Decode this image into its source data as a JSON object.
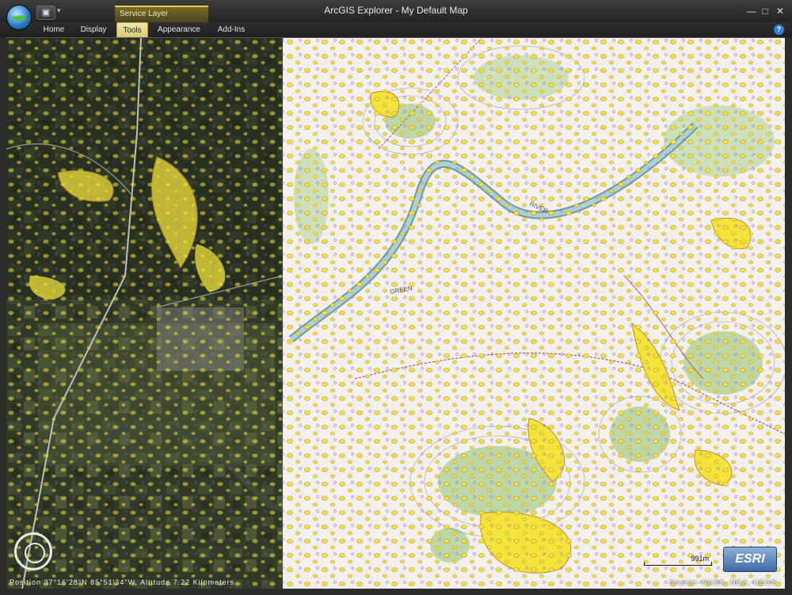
{
  "app": {
    "title": "ArcGIS Explorer - My Default Map",
    "contextual_tab": "Service Layer"
  },
  "ribbon": {
    "tabs": [
      {
        "label": "Home",
        "active": false
      },
      {
        "label": "Display",
        "active": false
      },
      {
        "label": "Tools",
        "active": true
      },
      {
        "label": "Appearance",
        "active": false
      },
      {
        "label": "Add-Ins",
        "active": false
      }
    ],
    "help_label": "?"
  },
  "window_controls": {
    "minimize": "—",
    "maximize": "□",
    "close": "✕"
  },
  "map": {
    "labels": [
      "RIVER",
      "GREEN"
    ],
    "scale_label": "991m",
    "position_text": "Position 37°16'28\"N  85°51'34\"W, Altitude  7.22 Kilometers",
    "source_text": "Source: NASA, NGA, USGS",
    "logo_text": "ESRI",
    "icons": [
      "save-icon",
      "navigation-control-icon",
      "help-icon"
    ]
  },
  "colors": {
    "highlight": "#f2e43a",
    "topo_bg": "#f1f0ec",
    "satellite_dark": "#2c3626",
    "river": "#9fc6c8",
    "contour": "#8a8a8a",
    "vegetation": "#8fbf6e"
  }
}
